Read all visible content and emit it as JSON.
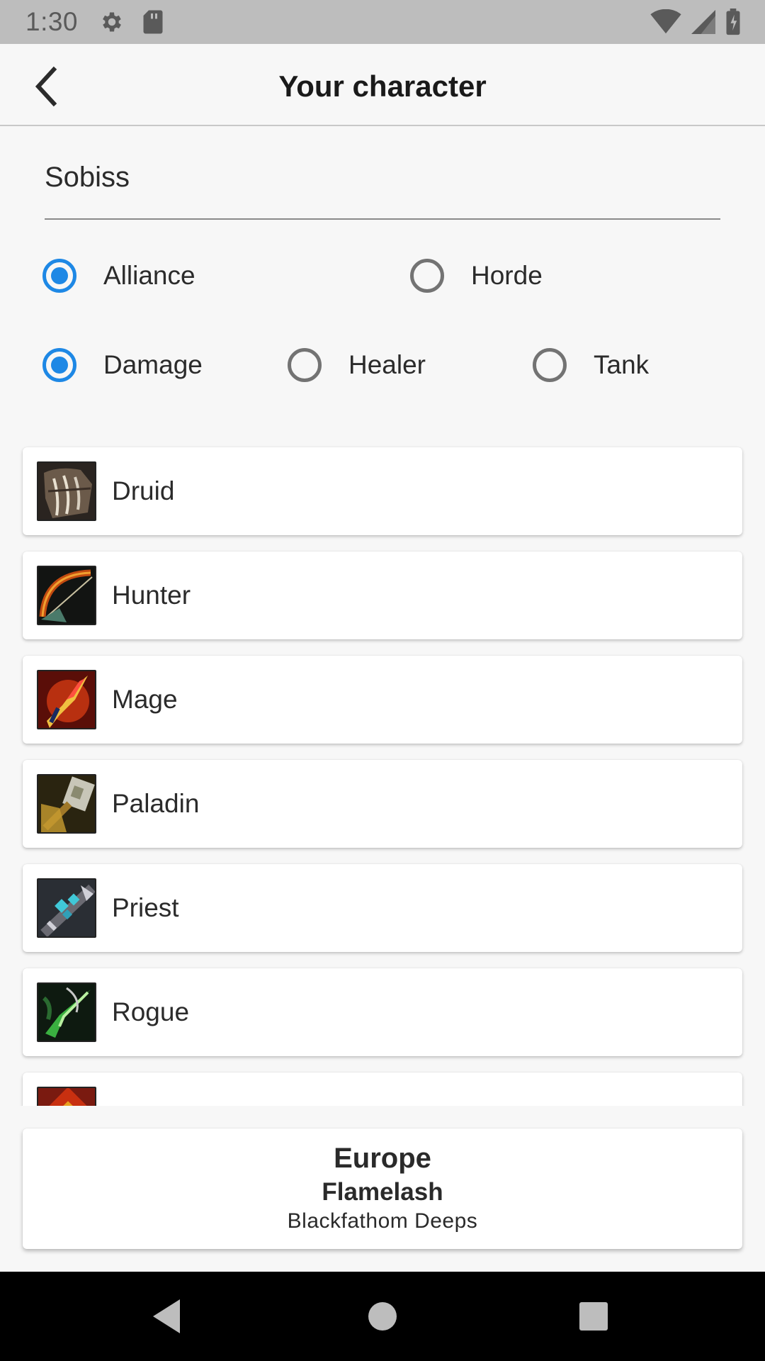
{
  "status_bar": {
    "time": "1:30",
    "icons": [
      "settings-icon",
      "sd-card-icon",
      "wifi-icon",
      "cell-signal-icon",
      "battery-icon"
    ]
  },
  "app_bar": {
    "title": "Your character",
    "back_icon": "chevron-left-icon"
  },
  "character_name": {
    "value": "Sobiss"
  },
  "faction": {
    "options": [
      {
        "label": "Alliance",
        "checked": true
      },
      {
        "label": "Horde",
        "checked": false
      }
    ]
  },
  "role": {
    "options": [
      {
        "label": "Damage",
        "checked": true
      },
      {
        "label": "Healer",
        "checked": false
      },
      {
        "label": "Tank",
        "checked": false
      }
    ]
  },
  "classes": [
    {
      "label": "Druid",
      "icon": "druid-claw-icon"
    },
    {
      "label": "Hunter",
      "icon": "hunter-bow-icon"
    },
    {
      "label": "Mage",
      "icon": "mage-fire-icon"
    },
    {
      "label": "Paladin",
      "icon": "paladin-hammer-icon"
    },
    {
      "label": "Priest",
      "icon": "priest-staff-icon"
    },
    {
      "label": "Rogue",
      "icon": "rogue-dagger-icon"
    },
    {
      "label": "",
      "icon": "shaman-icon"
    }
  ],
  "realm": {
    "region": "Europe",
    "server": "Flamelash",
    "zone": "Blackfathom Deeps"
  },
  "colors": {
    "accent": "#1e88e5",
    "status_bar": "#bdbdbd",
    "background": "#f7f7f7",
    "nav_bar": "#000000"
  },
  "nav_bar": {
    "icons": [
      "back-triangle-icon",
      "home-circle-icon",
      "recents-square-icon"
    ]
  }
}
